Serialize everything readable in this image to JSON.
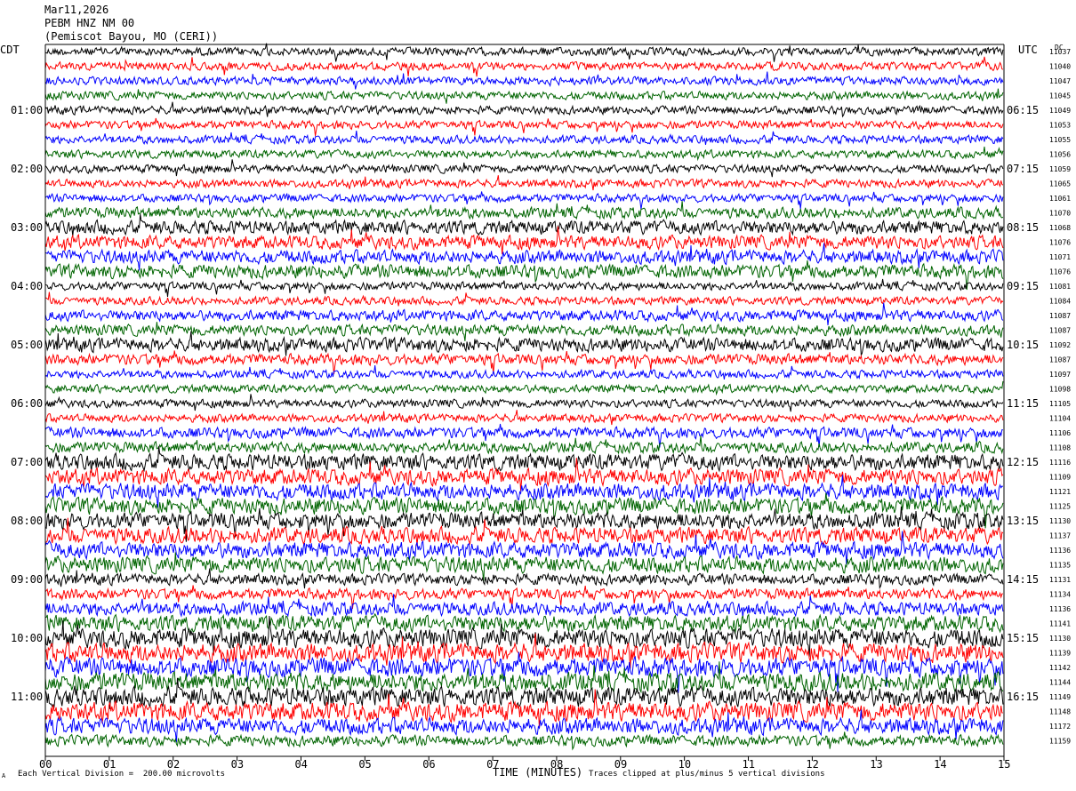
{
  "header": {
    "date": "Mar11,2026",
    "station": "PEBM HNZ NM 00",
    "location": "(Pemiscot Bayou, MO (CERI))"
  },
  "left_tz": "CDT",
  "right_tz": "UTC",
  "dc_label": "DC",
  "footer": {
    "corner_mark": "A",
    "scale_note": "Each Vertical Division =  200.00 microvolts",
    "clip_note": "Traces clipped at plus/minus 5 vertical divisions"
  },
  "colors": {
    "trace_cycle": [
      "#000000",
      "#ff0000",
      "#0000ff",
      "#006400"
    ],
    "frame": "#000000"
  },
  "chart_data": {
    "type": "line",
    "title": "PEBM HNZ NM 00",
    "xlabel": "TIME (MINUTES)",
    "x_ticks": [
      "00",
      "01",
      "02",
      "03",
      "04",
      "05",
      "06",
      "07",
      "08",
      "09",
      "10",
      "11",
      "12",
      "13",
      "14",
      "15"
    ],
    "xlim": [
      0,
      15
    ],
    "left_hour_labels": [
      "01:00",
      "02:00",
      "03:00",
      "04:00",
      "05:00",
      "06:00",
      "07:00",
      "08:00",
      "09:00",
      "10:00",
      "11:00"
    ],
    "right_hour_labels": [
      "06:15",
      "07:15",
      "08:15",
      "09:15",
      "10:15",
      "11:15",
      "12:15",
      "13:15",
      "14:15",
      "15:15",
      "16:15"
    ],
    "dc_offsets": [
      "11037",
      "11040",
      "11047",
      "11045",
      "11049",
      "11053",
      "11055",
      "11056",
      "11059",
      "11065",
      "11061",
      "11070",
      "11068",
      "11076",
      "11071",
      "11076",
      "11081",
      "11084",
      "11087",
      "11087",
      "11092",
      "11087",
      "11097",
      "11098",
      "11105",
      "11104",
      "11106",
      "11108",
      "11116",
      "11109",
      "11121",
      "11125",
      "11130",
      "11137",
      "11136",
      "11135",
      "11131",
      "11134",
      "11136",
      "11141",
      "11130",
      "11139",
      "11142",
      "11144",
      "11149",
      "11148",
      "11172",
      "11159"
    ],
    "rows_per_hour": 4,
    "row_amplitude_level": [
      3,
      3,
      3,
      3,
      3,
      3,
      3,
      3,
      3,
      3,
      3,
      4,
      5,
      5,
      5,
      5,
      3,
      3,
      4,
      4,
      5,
      4,
      3,
      3,
      3,
      3,
      4,
      4,
      6,
      6,
      6,
      6,
      6,
      6,
      6,
      6,
      4,
      4,
      5,
      6,
      7,
      7,
      7,
      7,
      7,
      7,
      6,
      4
    ]
  }
}
